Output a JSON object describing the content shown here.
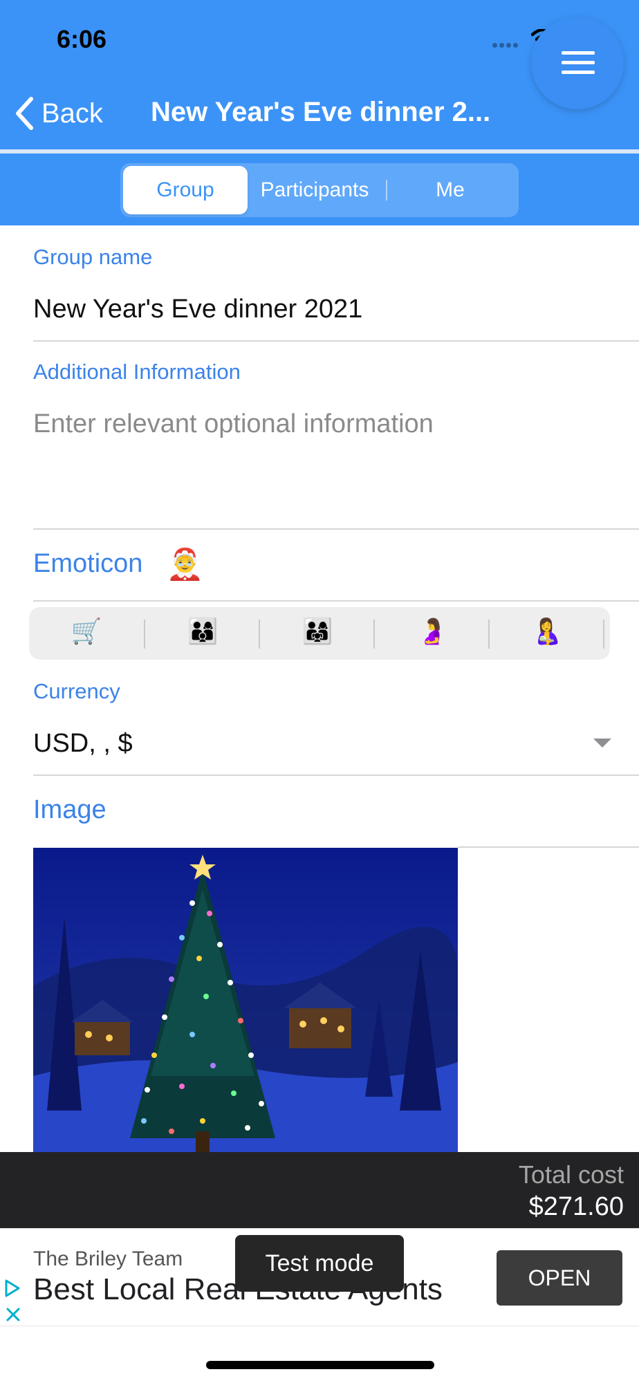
{
  "status_bar": {
    "time": "6:06"
  },
  "nav": {
    "back_label": "Back",
    "title": "New Year's Eve dinner 2..."
  },
  "tabs": [
    {
      "label": "Group",
      "selected": true
    },
    {
      "label": "Participants",
      "selected": false
    },
    {
      "label": "Me",
      "selected": false
    }
  ],
  "form": {
    "group_name_label": "Group name",
    "group_name_value": "New Year's Eve dinner 2021",
    "additional_label": "Additional Information",
    "additional_placeholder": "Enter relevant optional information",
    "emoticon_label": "Emoticon",
    "emoticon_value": "🤶",
    "emoticon_options": [
      "🛒",
      "👨‍👩‍👦",
      "👨‍👩‍👧",
      "🤰",
      "🤱"
    ],
    "currency_label": "Currency",
    "currency_value": "USD, , $",
    "image_label": "Image"
  },
  "footer": {
    "total_label": "Total cost",
    "total_value": "$271.60"
  },
  "ad": {
    "advertiser": "The Briley Team",
    "headline": "Best Local Real Estate Agents",
    "open_label": "OPEN",
    "test_mode_label": "Test mode"
  },
  "colors": {
    "primary": "#3b93f7",
    "label": "#3b83e8",
    "footer_bg": "#232325"
  },
  "icons": [
    "chevron-left-icon",
    "menu-icon",
    "wifi-icon",
    "battery-icon",
    "chevron-down-icon",
    "adchoices-icon",
    "close-icon"
  ]
}
